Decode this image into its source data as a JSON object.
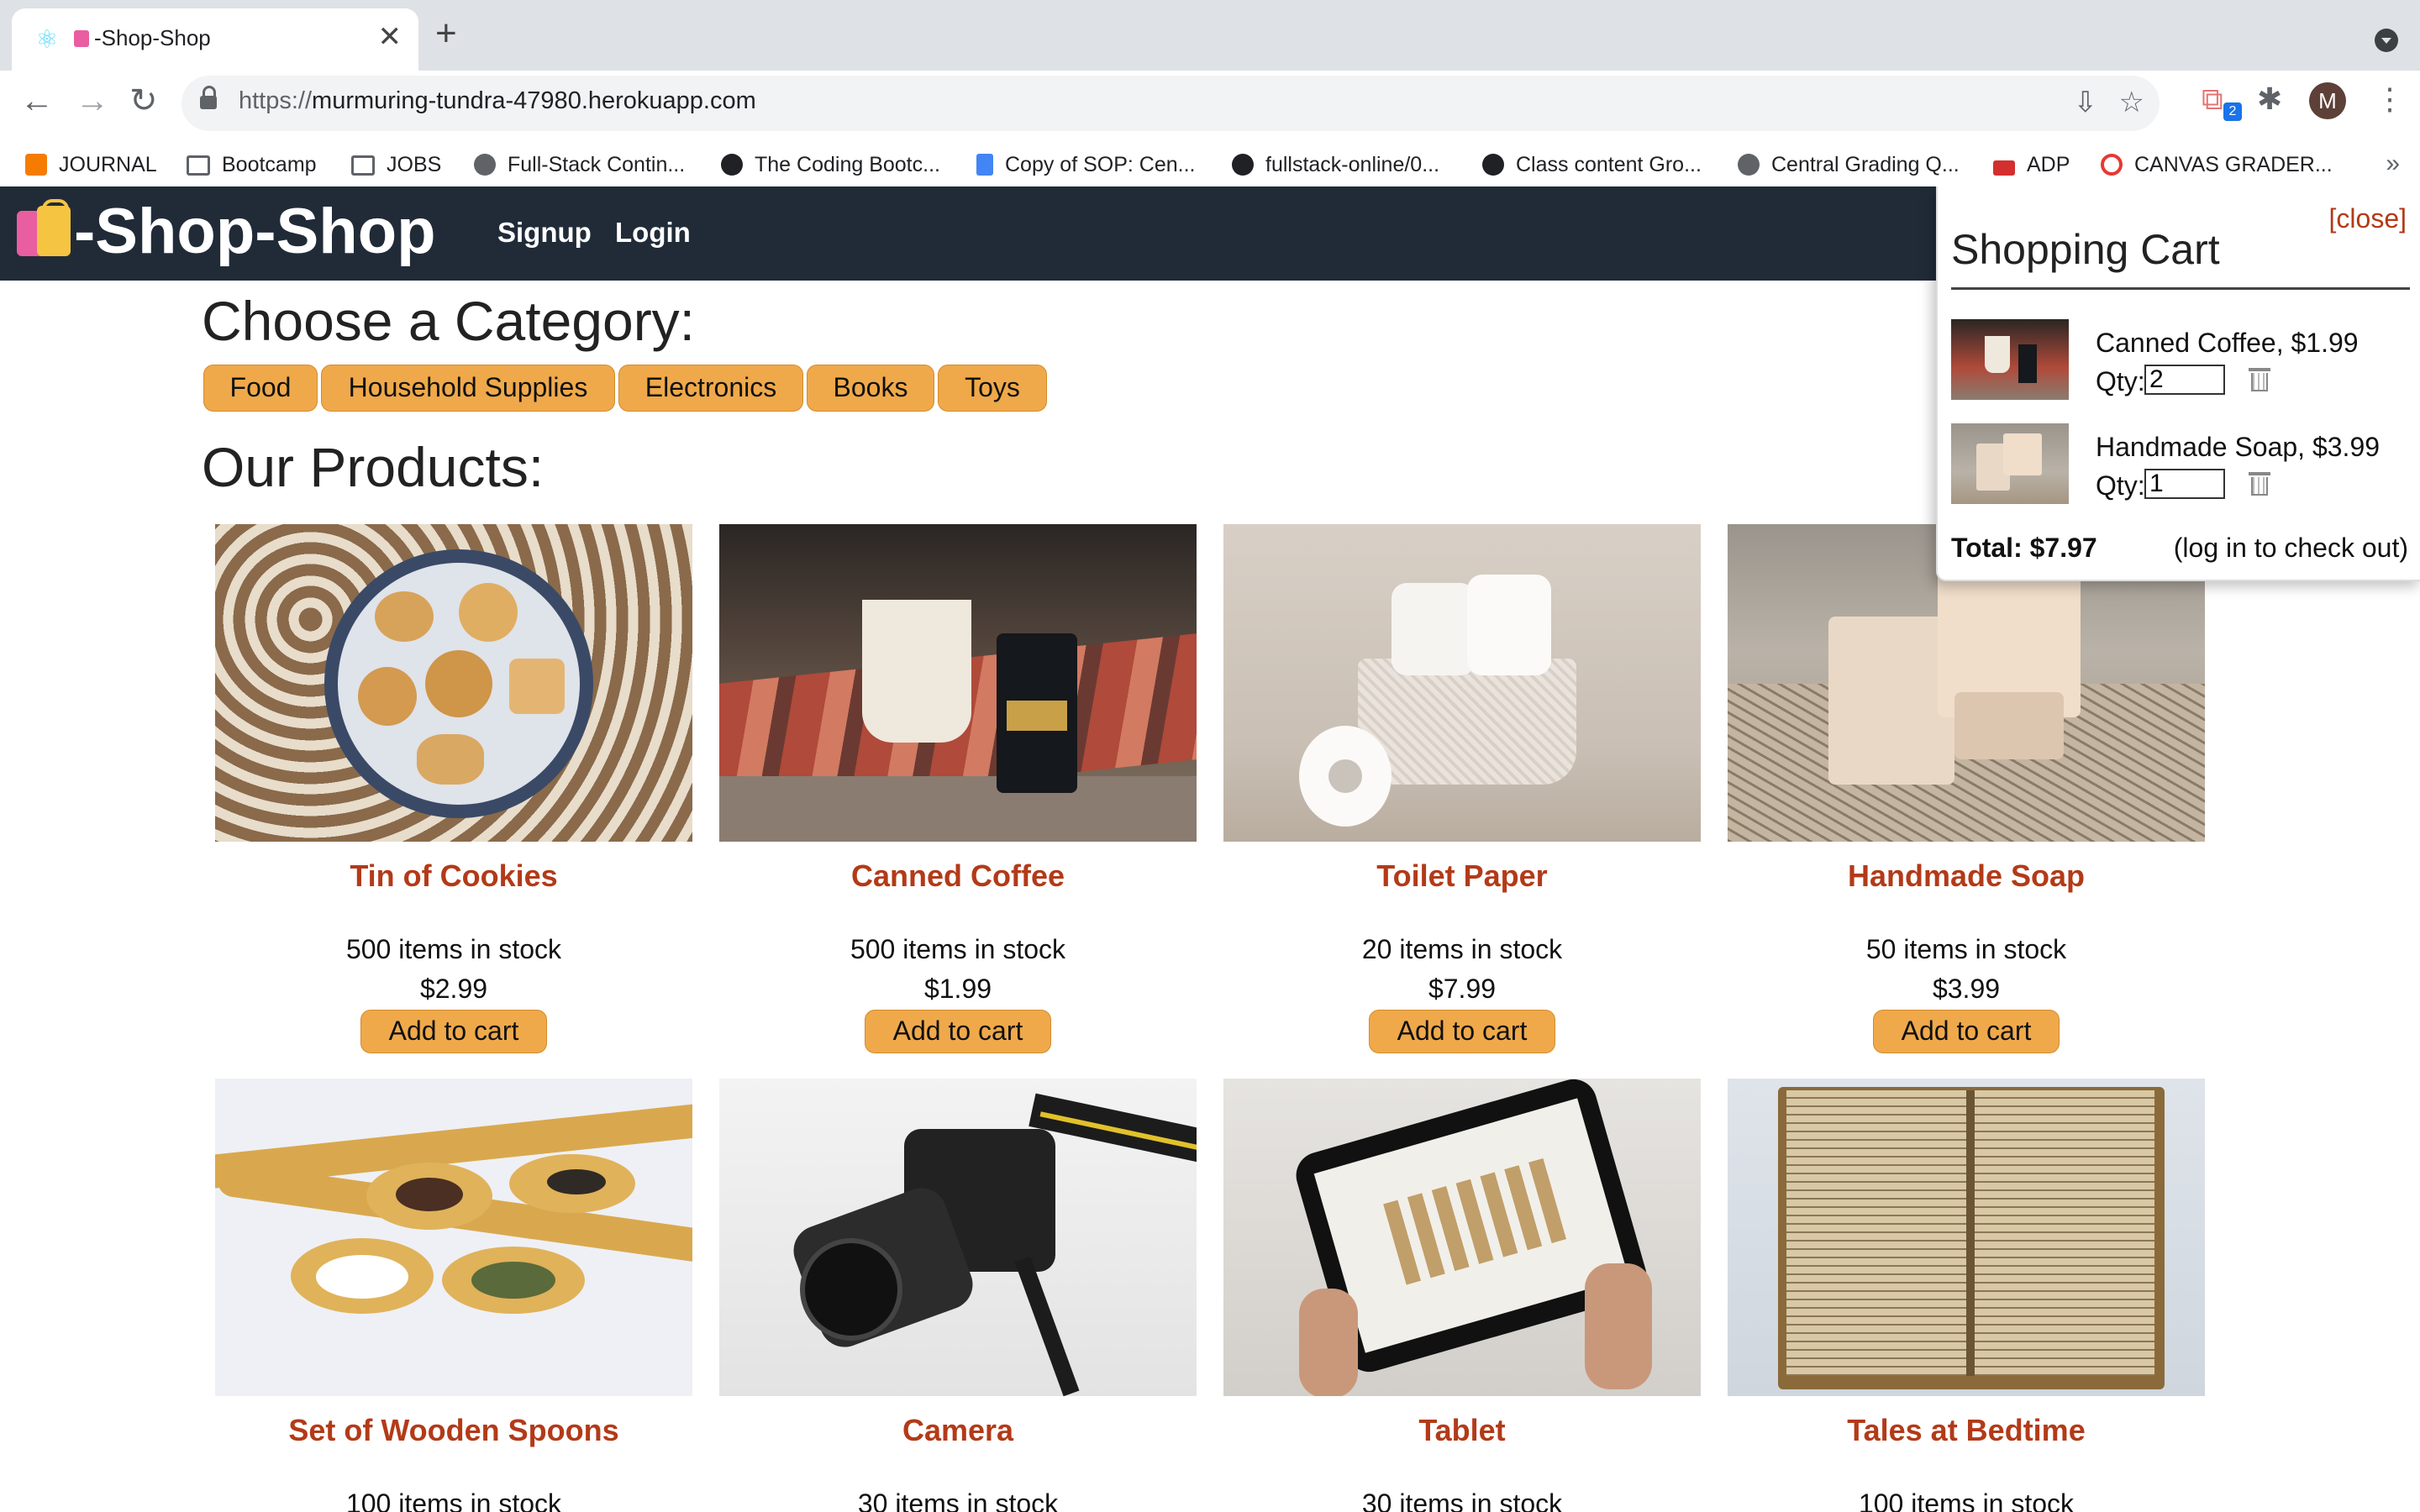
{
  "browser": {
    "tab_title": "-Shop-Shop",
    "tab_close": "✕",
    "new_tab": "+",
    "url_scheme": "https://",
    "url_host": "murmuring-tundra-47980.herokuapp.com",
    "avatar_letter": "M",
    "ext_badge": "2",
    "bookmarks": [
      "JOURNAL",
      "Bootcamp",
      "JOBS",
      "Full-Stack Contin...",
      "The Coding Bootc...",
      "Copy of SOP: Cen...",
      "fullstack-online/0...",
      "Class content Gro...",
      "Central Grading Q...",
      "ADP",
      "CANVAS GRADER..."
    ],
    "bookmarks_more": "»"
  },
  "header": {
    "logo_text": "-Shop-Shop",
    "nav": [
      "Signup",
      "Login"
    ]
  },
  "categories": {
    "heading": "Choose a Category:",
    "items": [
      "Food",
      "Household Supplies",
      "Electronics",
      "Books",
      "Toys"
    ]
  },
  "products": {
    "heading": "Our Products:",
    "add_label": "Add to cart",
    "items": [
      {
        "name": "Tin of Cookies",
        "stock": "500 items in stock",
        "price": "$2.99"
      },
      {
        "name": "Canned Coffee",
        "stock": "500 items in stock",
        "price": "$1.99"
      },
      {
        "name": "Toilet Paper",
        "stock": "20 items in stock",
        "price": "$7.99"
      },
      {
        "name": "Handmade Soap",
        "stock": "50 items in stock",
        "price": "$3.99"
      },
      {
        "name": "Set of Wooden Spoons",
        "stock": "100 items in stock",
        "price": ""
      },
      {
        "name": "Camera",
        "stock": "30 items in stock",
        "price": ""
      },
      {
        "name": "Tablet",
        "stock": "30 items in stock",
        "price": ""
      },
      {
        "name": "Tales at Bedtime",
        "stock": "100 items in stock",
        "price": ""
      }
    ]
  },
  "cart": {
    "close_label": "[close]",
    "title": "Shopping Cart",
    "qty_label": "Qty:",
    "items": [
      {
        "label": "Canned Coffee, $1.99",
        "qty": "2"
      },
      {
        "label": "Handmade Soap, $3.99",
        "qty": "1"
      }
    ],
    "total": "Total: $7.97",
    "checkout_note": "(log in to check out)"
  },
  "colors": {
    "header_bg": "#212b38",
    "accent_button": "#efa94a",
    "product_name": "#b33a18"
  }
}
